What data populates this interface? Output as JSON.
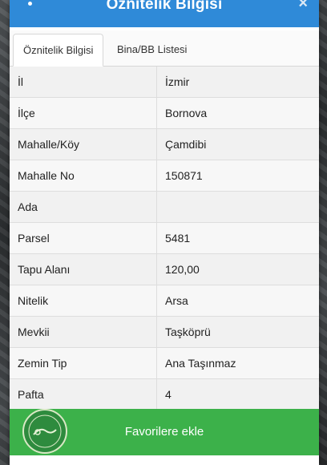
{
  "dialog": {
    "title": "Öznitelik Bilgisi",
    "close_label": "×"
  },
  "tabs": [
    {
      "label": "Öznitelik Bilgisi",
      "active": true
    },
    {
      "label": "Bina/BB Listesi",
      "active": false
    }
  ],
  "attributes": [
    {
      "key": "İl",
      "value": "İzmir"
    },
    {
      "key": "İlçe",
      "value": "Bornova"
    },
    {
      "key": "Mahalle/Köy",
      "value": "Çamdibi"
    },
    {
      "key": "Mahalle No",
      "value": "150871"
    },
    {
      "key": "Ada",
      "value": ""
    },
    {
      "key": "Parsel",
      "value": "5481"
    },
    {
      "key": "Tapu Alanı",
      "value": "120,00"
    },
    {
      "key": "Nitelik",
      "value": "Arsa"
    },
    {
      "key": "Mevkii",
      "value": "Taşköprü"
    },
    {
      "key": "Zemin Tip",
      "value": "Ana Taşınmaz"
    },
    {
      "key": "Pafta",
      "value": "4"
    }
  ],
  "actions": {
    "favorite_label": "Favorilere ekle"
  },
  "colors": {
    "header": "#2f8ad8",
    "favorite_button": "#3cb14a"
  }
}
